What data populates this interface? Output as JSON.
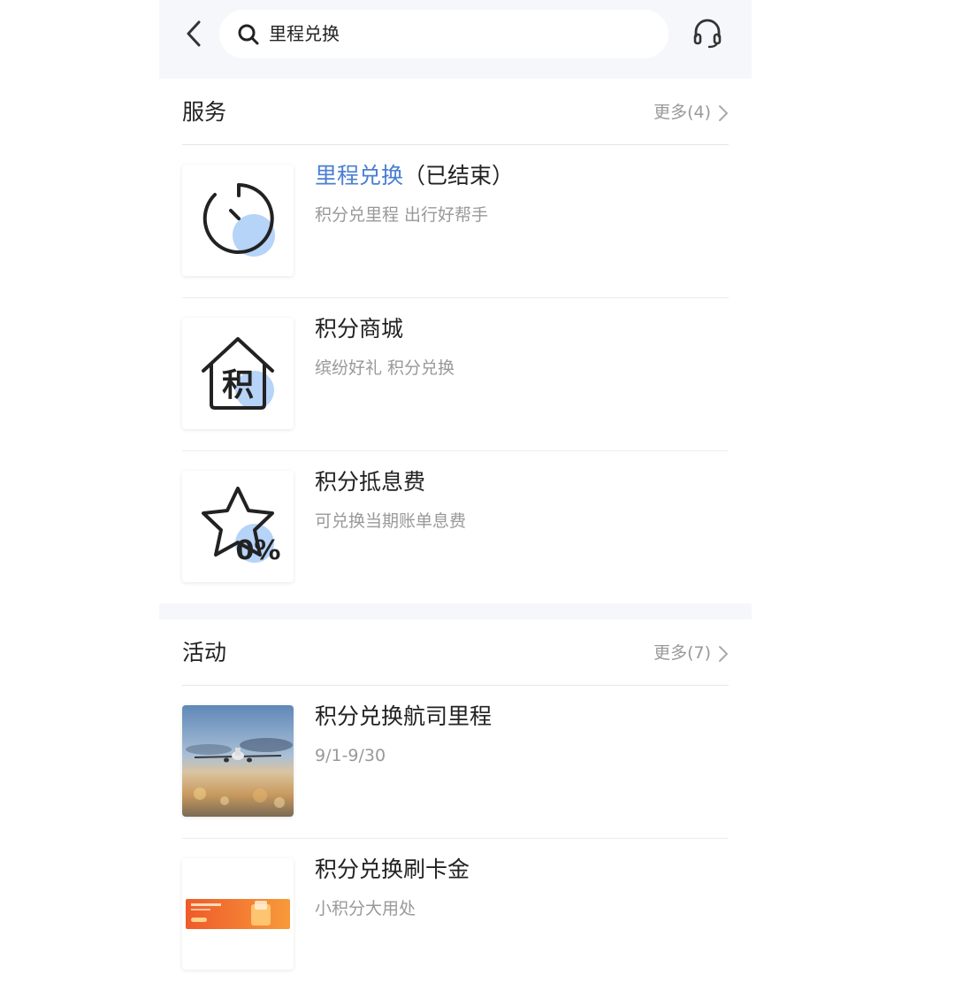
{
  "header": {
    "back_icon": "chevron-left-icon",
    "search_icon": "search-icon",
    "search_value": "里程兑换",
    "support_icon": "headset-icon"
  },
  "services": {
    "title": "服务",
    "more_label": "更多(4)",
    "items": [
      {
        "title_highlight": "里程兑换",
        "title_suffix": "（已结束）",
        "subtitle": "积分兑里程 出行好帮手",
        "icon": "clock-icon"
      },
      {
        "title": "积分商城",
        "subtitle": "缤纷好礼 积分兑换",
        "icon": "points-mall-house-icon",
        "icon_glyph": "积"
      },
      {
        "title": "积分抵息费",
        "subtitle": "可兑换当期账单息费",
        "icon": "star-zero-percent-icon",
        "icon_glyph": "0%"
      }
    ]
  },
  "activities": {
    "title": "活动",
    "more_label": "更多(7)",
    "items": [
      {
        "title": "积分兑换航司里程",
        "subtitle": "9/1-9/30",
        "image": "airplane-photo"
      },
      {
        "title": "积分兑换刷卡金",
        "subtitle": "小积分大用处",
        "image": "card-gold-banner"
      }
    ]
  },
  "colors": {
    "accent": "#4a7fd1",
    "header_bg": "#f6f7fb",
    "muted_text": "#999999",
    "icon_blue": "#a9cbf7"
  }
}
